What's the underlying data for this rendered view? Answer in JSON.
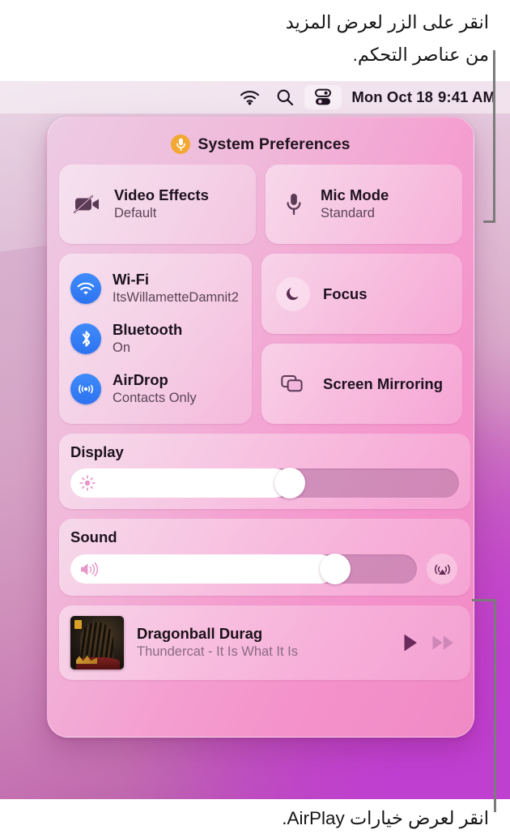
{
  "captions": {
    "top_line1": "انقر على الزر لعرض المزيد",
    "top_line2": "من عناصر التحكم.",
    "bottom": "انقر لعرض خيارات AirPlay."
  },
  "menubar": {
    "wifi_icon": "wifi-icon",
    "search_icon": "search-icon",
    "control_center_icon": "control-center-icon",
    "date": "Mon Oct 18",
    "time": "9:41 AM"
  },
  "control_center": {
    "header": {
      "icon": "microphone-icon",
      "title": "System Preferences"
    },
    "top_tiles": [
      {
        "icon": "video-off-icon",
        "title": "Video Effects",
        "subtitle": "Default"
      },
      {
        "icon": "microphone-icon",
        "title": "Mic Mode",
        "subtitle": "Standard"
      }
    ],
    "connectivity": [
      {
        "icon": "wifi-icon",
        "title": "Wi-Fi",
        "subtitle": "ItsWillametteDamnit2"
      },
      {
        "icon": "bluetooth-icon",
        "title": "Bluetooth",
        "subtitle": "On"
      },
      {
        "icon": "airdrop-icon",
        "title": "AirDrop",
        "subtitle": "Contacts Only"
      }
    ],
    "right_tiles": [
      {
        "icon": "moon-icon",
        "label": "Focus"
      },
      {
        "icon": "screen-mirroring-icon",
        "label": "Screen Mirroring"
      }
    ],
    "display": {
      "label": "Display",
      "icon": "brightness-icon",
      "value_percent": 57
    },
    "sound": {
      "label": "Sound",
      "icon": "speaker-icon",
      "value_percent": 79,
      "airplay_icon": "airplay-audio-icon"
    },
    "now_playing": {
      "title": "Dragonball Durag",
      "subtitle": "Thundercat - It Is What It Is",
      "artwork": "album-artwork",
      "play_icon": "play-icon",
      "next_icon": "fast-forward-icon"
    }
  },
  "colors": {
    "accent_blue": "#3f8bfb",
    "mic_badge": "#f3a833",
    "panel_pink": "#f49fd0",
    "callout_gray": "#7b7b7b",
    "text_primary": "#1d1220",
    "text_secondary": "#5d4458"
  }
}
